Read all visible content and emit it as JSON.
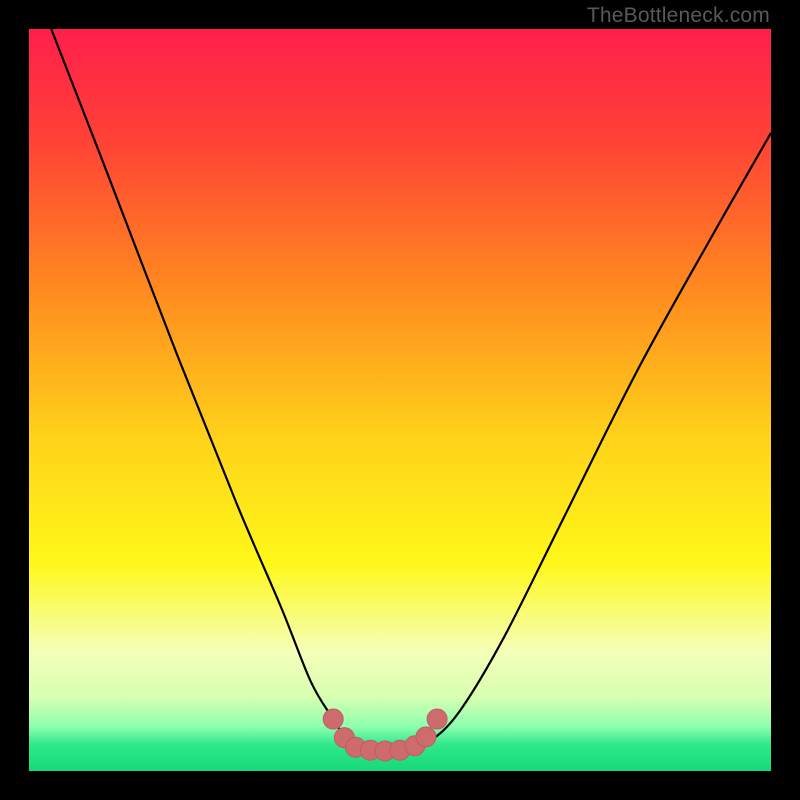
{
  "watermark": "TheBottleneck.com",
  "chart_data": {
    "type": "line",
    "title": "",
    "xlabel": "",
    "ylabel": "",
    "xlim": [
      0,
      100
    ],
    "ylim": [
      0,
      100
    ],
    "grid": false,
    "legend": false,
    "series": [
      {
        "name": "bottleneck-curve",
        "x": [
          3,
          10,
          20,
          28,
          34,
          38,
          41,
          43,
          45,
          48,
          51,
          54,
          58,
          64,
          72,
          82,
          92,
          100
        ],
        "y": [
          100,
          82,
          56,
          36,
          22,
          12,
          7,
          4,
          3,
          3,
          3,
          4,
          8,
          18,
          34,
          54,
          72,
          86
        ]
      }
    ],
    "markers": {
      "name": "highlight-points",
      "color": "#cd6b6d",
      "stroke": "#c45a60",
      "radius": 10,
      "points": [
        {
          "x": 41,
          "y": 7
        },
        {
          "x": 42.5,
          "y": 4.5
        },
        {
          "x": 44,
          "y": 3.2
        },
        {
          "x": 46,
          "y": 2.8
        },
        {
          "x": 48,
          "y": 2.7
        },
        {
          "x": 50,
          "y": 2.8
        },
        {
          "x": 52,
          "y": 3.4
        },
        {
          "x": 53.5,
          "y": 4.6
        },
        {
          "x": 55,
          "y": 7
        }
      ]
    },
    "background_gradient": {
      "stops": [
        {
          "offset": 0.0,
          "color": "#ff1f4b"
        },
        {
          "offset": 0.15,
          "color": "#ff4236"
        },
        {
          "offset": 0.35,
          "color": "#ff8a1f"
        },
        {
          "offset": 0.55,
          "color": "#ffd21a"
        },
        {
          "offset": 0.72,
          "color": "#fff81a"
        },
        {
          "offset": 0.84,
          "color": "#f4ffba"
        },
        {
          "offset": 0.9,
          "color": "#d8ffb0"
        },
        {
          "offset": 0.94,
          "color": "#8dffb0"
        },
        {
          "offset": 0.965,
          "color": "#2ee889"
        },
        {
          "offset": 1.0,
          "color": "#17d97a"
        }
      ]
    }
  }
}
